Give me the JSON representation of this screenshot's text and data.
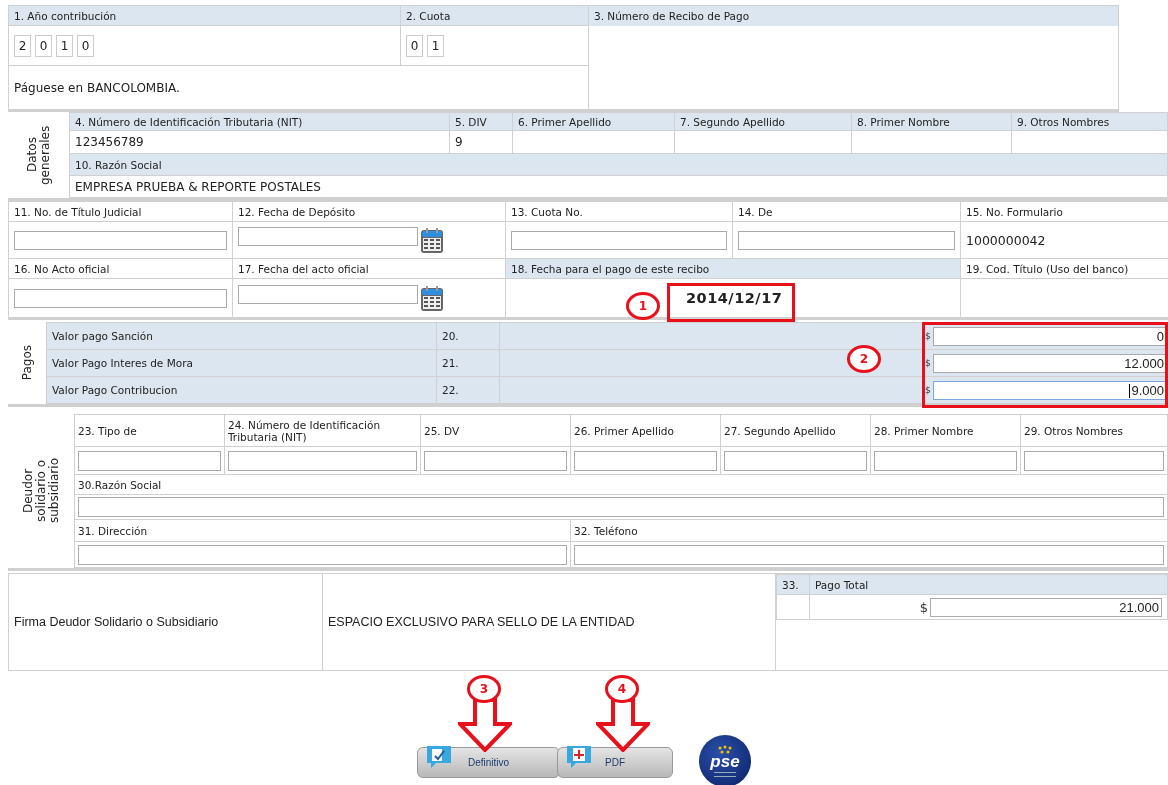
{
  "header": {
    "year": {
      "label": "1. Año contribución",
      "digits": [
        "2",
        "0",
        "1",
        "0"
      ]
    },
    "cuota": {
      "label": "2. Cuota",
      "digits": [
        "0",
        "1"
      ]
    },
    "receipt": {
      "label": "3. Número de Recibo de Pago"
    },
    "bank_note": "Páguese en BANCOLOMBIA."
  },
  "datos_generales": {
    "title": "Datos generales",
    "fields": [
      {
        "label": "4. Número de Identificación Tributaria (NIT)",
        "value": "123456789"
      },
      {
        "label": "5. DIV",
        "value": "9"
      },
      {
        "label": "6. Primer Apellido"
      },
      {
        "label": "7. Segundo Apellido"
      },
      {
        "label": "8. Primer Nombre"
      },
      {
        "label": "9. Otros Nombres"
      }
    ],
    "razon_social": {
      "label": "10. Razón Social",
      "value": "EMPRESA PRUEBA & REPORTE POSTALES"
    }
  },
  "details": [
    [
      {
        "label": "11. No. de Título Judicial",
        "kind": "input"
      },
      {
        "label": "12. Fecha de Depósito",
        "kind": "date"
      },
      {
        "label": "13. Cuota No.",
        "kind": "input"
      },
      {
        "label": "14. De",
        "kind": "input"
      },
      {
        "label": "15. No. Formulario",
        "kind": "text",
        "value": "1000000042"
      }
    ],
    [
      {
        "label": "16. No Acto oficial",
        "kind": "input"
      },
      {
        "label": "17. Fecha del acto oficial",
        "kind": "date"
      },
      {
        "label": "18. Fecha para el pago de este recibo",
        "kind": "highlight",
        "value": "2014/12/17"
      },
      {
        "label": "19. Cod. Título (Uso del banco)",
        "kind": "empty"
      }
    ]
  ],
  "pagos": {
    "title": "Pagos",
    "rows": [
      {
        "label": "Valor pago Sanción",
        "number": "20.",
        "currency": "$",
        "value": "0",
        "focused": false
      },
      {
        "label": "Valor Pago Interes de Mora",
        "number": "21.",
        "currency": "$",
        "value": "12.000",
        "focused": false
      },
      {
        "label": "Valor Pago Contribucion",
        "number": "22.",
        "currency": "$",
        "value": "9.000",
        "focused": true
      }
    ]
  },
  "deudor": {
    "title": "Deudor solidario o subsidiario",
    "fields": [
      {
        "label": "23. Tipo de"
      },
      {
        "label": "24. Número de Identificación Tributaria (NIT)"
      },
      {
        "label": "25. DV"
      },
      {
        "label": "26. Primer Apellido"
      },
      {
        "label": "27. Segundo Apellido"
      },
      {
        "label": "28. Primer Nombre"
      },
      {
        "label": "29. Otros Nombres"
      }
    ],
    "razon_social": {
      "label": "30.Razón Social"
    },
    "contact": [
      {
        "label": "31. Dirección"
      },
      {
        "label": "32. Teléfono"
      }
    ]
  },
  "footer": {
    "signature": "Firma Deudor Solidario o Subsidiario",
    "stamp": "ESPACIO EXCLUSIVO PARA SELLO DE LA ENTIDAD",
    "total": {
      "number": "33.",
      "label": "Pago Total",
      "currency": "$",
      "value": "21.000"
    }
  },
  "buttons": [
    {
      "label": "Definitivo",
      "kind": "definitive"
    },
    {
      "label": "PDF",
      "kind": "pdf"
    }
  ],
  "pse_logo": {
    "text": "pse"
  },
  "annotations": [
    {
      "label": "1"
    },
    {
      "label": "2"
    },
    {
      "label": "3"
    },
    {
      "label": "4"
    }
  ]
}
